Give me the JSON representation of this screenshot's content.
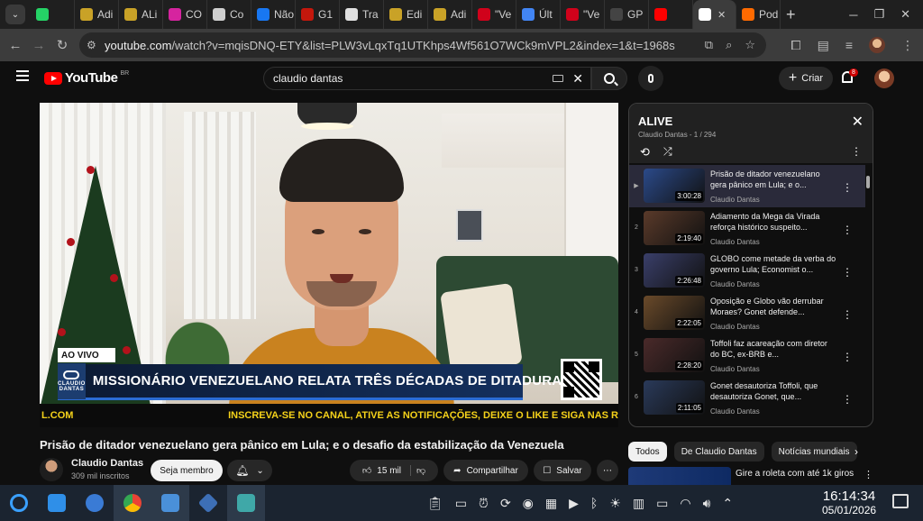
{
  "browser": {
    "tabs": [
      {
        "label": "",
        "icon": "whatsapp-icon",
        "color": "#25d366"
      },
      {
        "label": "Adi",
        "icon": "bookmark-icon",
        "color": "#c9a227"
      },
      {
        "label": "ALi",
        "icon": "bookmark-icon",
        "color": "#c9a227"
      },
      {
        "label": "CO",
        "icon": "instagram-icon",
        "color": "#d6249f"
      },
      {
        "label": "Co",
        "icon": "chatgpt-icon",
        "color": "#cfcfcf"
      },
      {
        "label": "Não",
        "icon": "meta-icon",
        "color": "#1877f2"
      },
      {
        "label": "G1",
        "icon": "g1-icon",
        "color": "#c4170c"
      },
      {
        "label": "Tra",
        "icon": "pause-icon",
        "color": "#e0e0e0"
      },
      {
        "label": "Edi",
        "icon": "bookmark-icon",
        "color": "#c9a227"
      },
      {
        "label": "Adi",
        "icon": "bookmark-icon",
        "color": "#c9a227"
      },
      {
        "label": "\"Ve",
        "icon": "m-icon",
        "color": "#d0021b"
      },
      {
        "label": "Últ",
        "icon": "google-icon",
        "color": "#4285f4"
      },
      {
        "label": "\"Ve",
        "icon": "m-icon",
        "color": "#d0021b"
      },
      {
        "label": "GP",
        "icon": "g-icon",
        "color": "#444444"
      },
      {
        "label": "",
        "icon": "youtube-icon",
        "color": "#ff0000"
      },
      {
        "label": "",
        "icon": "speaker-icon",
        "color": "#ffffff",
        "active": true
      },
      {
        "label": "Pod",
        "icon": "podcast-icon",
        "color": "#ff6a00"
      }
    ],
    "url_host": "youtube.com",
    "url_rest": "/watch?v=mqisDNQ-ETY&list=PLW3vLqxTq1UTKhps4Wf561O7WCk9mVPL2&index=1&t=1968s"
  },
  "youtube": {
    "logo_text": "YouTube",
    "country": "BR",
    "search_value": "claudio dantas",
    "create_label": "Criar",
    "notif_count": "8"
  },
  "player": {
    "live_label": "AO VIVO",
    "brand_line1": "CLAUDIO",
    "brand_line2": "DANTAS",
    "headline": "MISSIONÁRIO VENEZUELANO RELATA TRÊS DÉCADAS DE DITADURA",
    "ticker_left": "L.COM",
    "ticker_right": "INSCREVA-SE NO CANAL, ATIVE AS NOTIFICAÇÕES, DEIXE O LIKE E SIGA NAS R"
  },
  "video": {
    "title": "Prisão de ditador venezuelano gera pânico em Lula; e o desafio da estabilização da Venezuela",
    "channel": "Claudio Dantas",
    "subscribers": "309 mil inscritos",
    "join_label": "Seja membro",
    "likes": "15 mil",
    "share_label": "Compartilhar",
    "save_label": "Salvar"
  },
  "playlist": {
    "title": "ALIVE",
    "subtitle": "Claudio Dantas - 1 / 294",
    "items": [
      {
        "index": "▶",
        "title": "Prisão de ditador venezuelano gera pânico em Lula; e o...",
        "channel": "Claudio Dantas",
        "duration": "3:00:28",
        "thumb_color": "#2b4a8a"
      },
      {
        "index": "2",
        "title": "Adiamento da Mega da Virada reforça histórico suspeito...",
        "channel": "Claudio Dantas",
        "duration": "2:19:40",
        "thumb_color": "#5a3a2a"
      },
      {
        "index": "3",
        "title": "GLOBO come metade da verba do governo Lula; Economist o...",
        "channel": "Claudio Dantas",
        "duration": "2:26:48",
        "thumb_color": "#3a3f6a"
      },
      {
        "index": "4",
        "title": "Oposição e Globo vão derrubar Moraes? Gonet defende...",
        "channel": "Claudio Dantas",
        "duration": "2:22:05",
        "thumb_color": "#6a4a2a"
      },
      {
        "index": "5",
        "title": "Toffoli faz acareação com diretor do BC, ex-BRB e...",
        "channel": "Claudio Dantas",
        "duration": "2:28:20",
        "thumb_color": "#4a2a2a"
      },
      {
        "index": "6",
        "title": "Gonet desautoriza Toffoli, que desautoriza Gonet, que...",
        "channel": "Claudio Dantas",
        "duration": "2:11:05",
        "thumb_color": "#2a3a5a"
      }
    ]
  },
  "chips": [
    "Todos",
    "De Claudio Dantas",
    "Notícias mundiais"
  ],
  "recommendation": {
    "title": "Gire a roleta com até 1k giros"
  },
  "taskbar": {
    "time": "16:14:34",
    "date": "05/01/2026"
  }
}
